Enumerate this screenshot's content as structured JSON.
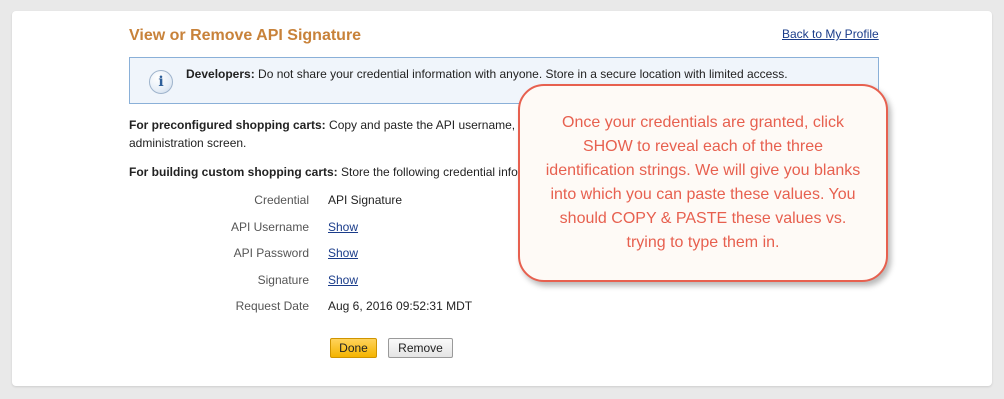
{
  "page": {
    "title": "View or Remove API Signature",
    "back_link": "Back to My Profile"
  },
  "notice": {
    "icon": "info-icon",
    "bold": "Developers:",
    "text": " Do not share your credential information with anyone. Store in a secure location with limited access."
  },
  "preconfigured": {
    "bold": "For preconfigured shopping carts:",
    "text": " Copy and paste the API username,",
    "text_line2": "administration screen."
  },
  "custom": {
    "bold": "For building custom shopping carts:",
    "text": " Store the following credential infor"
  },
  "credentials": {
    "credential": {
      "label": "Credential",
      "value": "API Signature"
    },
    "api_username": {
      "label": "API Username",
      "value": "Show"
    },
    "api_password": {
      "label": "API Password",
      "value": "Show"
    },
    "signature": {
      "label": "Signature",
      "value": "Show"
    },
    "request_date": {
      "label": "Request Date",
      "value": "Aug 6, 2016 09:52:31 MDT"
    }
  },
  "buttons": {
    "done": "Done",
    "remove": "Remove"
  },
  "callout": {
    "text": "Once your credentials are granted, click SHOW to reveal each of the three identification strings. We will give you blanks into which you can paste these values. You should COPY & PASTE these values vs. trying to type them in.",
    "color": "#e7604f"
  }
}
